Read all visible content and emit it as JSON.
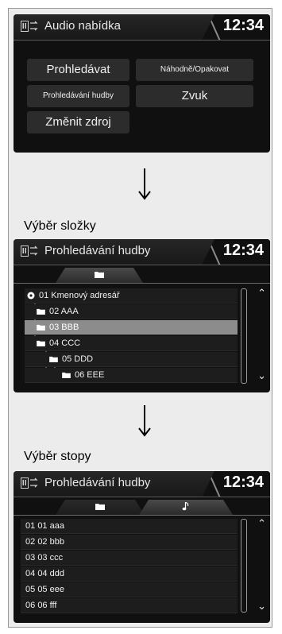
{
  "header_clock": "12:34",
  "screen1": {
    "title": "Audio nabídka",
    "buttons": {
      "prohledavat": "Prohledávat",
      "nahodne": "Náhodně/Opakovat",
      "prohledavani_hudby": "Prohledávání hudby",
      "zvuk": "Zvuk",
      "zmenit_zdroj": "Změnit zdroj"
    }
  },
  "caption_folder": "Výběr složky",
  "screen2": {
    "title": "Prohledávání hudby",
    "folders": [
      {
        "label": "01 Kmenový adresář",
        "selected": false
      },
      {
        "label": "02 AAA",
        "selected": false
      },
      {
        "label": "03 BBB",
        "selected": true
      },
      {
        "label": "04 CCC",
        "selected": false
      },
      {
        "label": "05 DDD",
        "selected": false
      },
      {
        "label": "06 EEE",
        "selected": false
      }
    ]
  },
  "caption_track": "Výběr stopy",
  "screen3": {
    "title": "Prohledávání hudby",
    "tracks": [
      {
        "num": "01",
        "name": "01 aaa"
      },
      {
        "num": "02",
        "name": "02 bbb"
      },
      {
        "num": "03",
        "name": "03 ccc"
      },
      {
        "num": "04",
        "name": "04 ddd"
      },
      {
        "num": "05",
        "name": "05 eee"
      },
      {
        "num": "06",
        "name": "06 fff"
      }
    ]
  },
  "icons": {
    "source": "music-source-icon",
    "folder": "folder-icon",
    "note": "music-note-icon",
    "root": "root-folder-icon",
    "scroll_up": "chevron-double-up-icon",
    "scroll_down": "chevron-double-down-icon",
    "arrow": "arrow-down-icon"
  },
  "colors": {
    "screen_bg": "#101010",
    "button_bg": "#2c2c2c",
    "selected_row": "#8c8c8c",
    "frame_bg": "#ececec"
  }
}
